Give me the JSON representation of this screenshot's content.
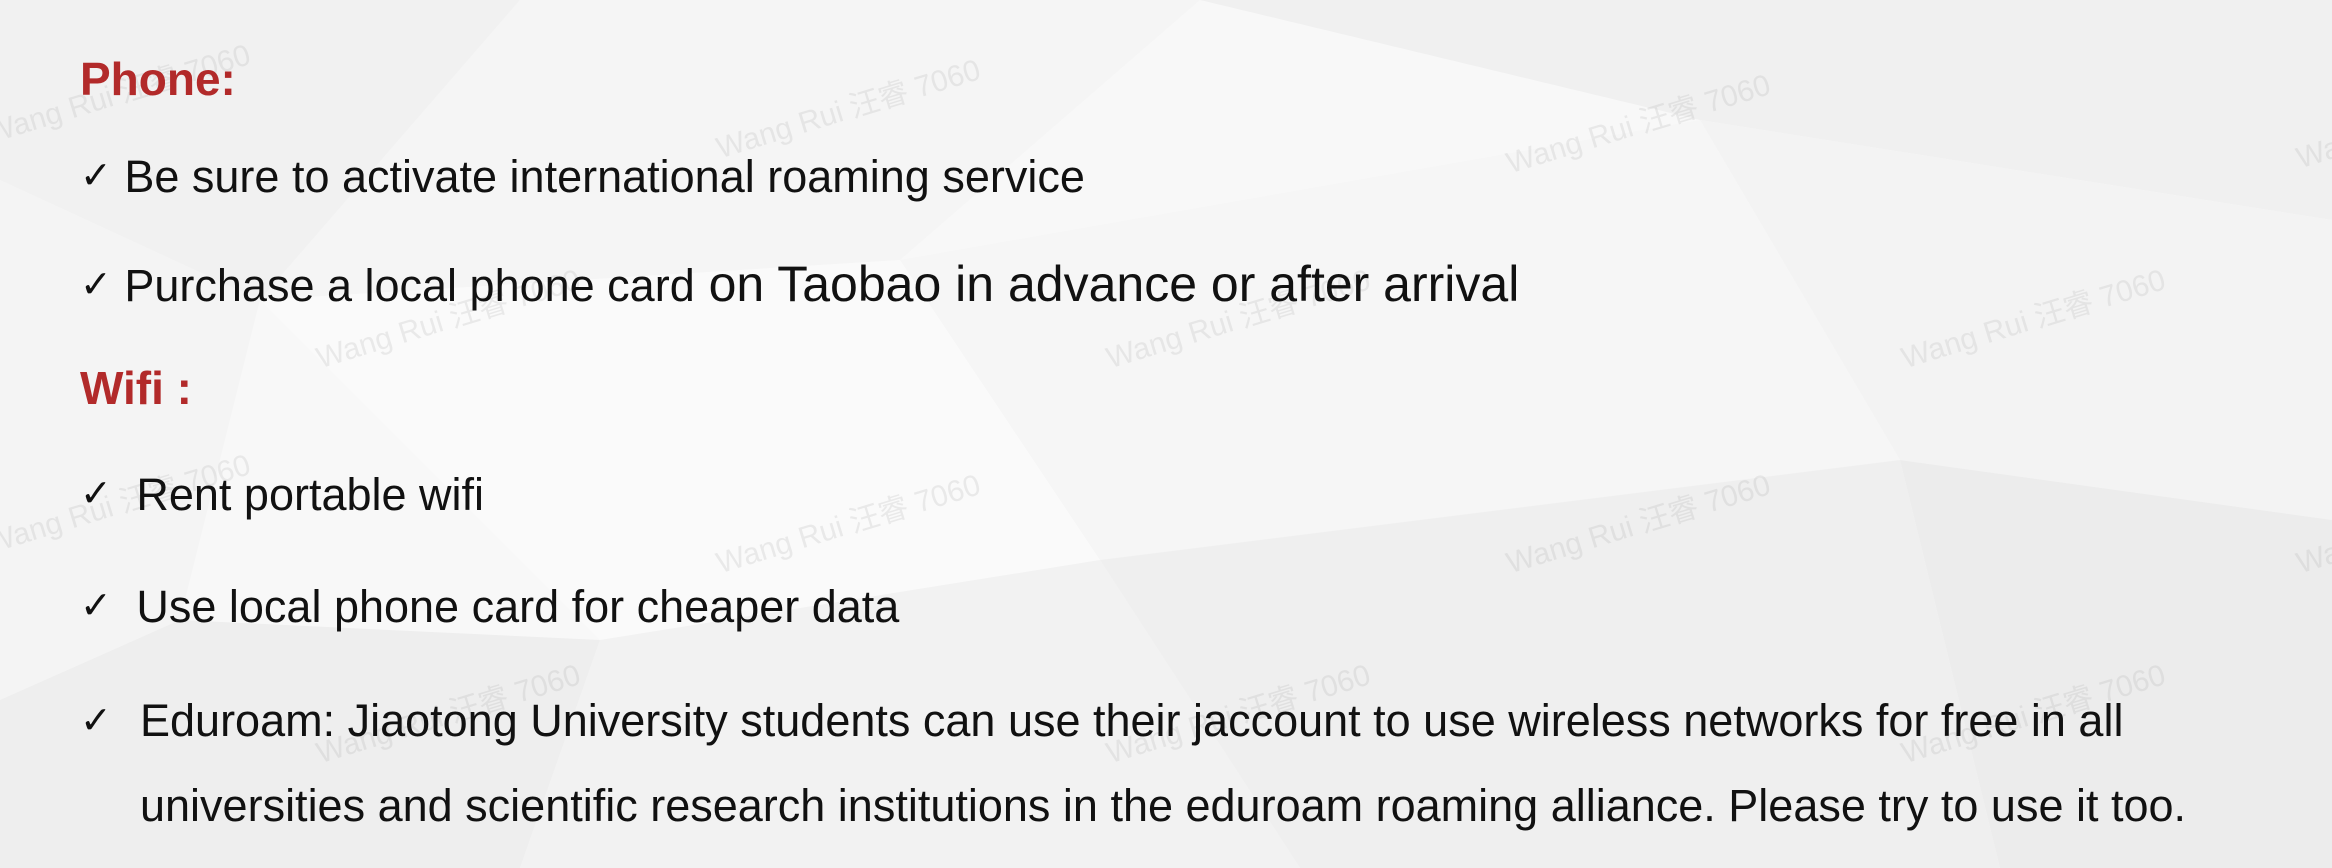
{
  "watermark": "Wang Rui 汪睿 7060",
  "colors": {
    "heading": "#b22a2a",
    "text": "#111111",
    "background": "#f7f7f7"
  },
  "sections": {
    "phone": {
      "heading": "Phone:",
      "items": [
        {
          "check": "✓",
          "text": "Be sure to activate international roaming service"
        },
        {
          "check": "✓",
          "text_a": "Purchase a local phone card",
          "text_b": " on Taobao in advance or after arrival"
        }
      ]
    },
    "wifi": {
      "heading": "Wifi :",
      "items": [
        {
          "check": "✓",
          "text": "Rent portable wifi"
        },
        {
          "check": "✓",
          "text": "Use local phone card for cheaper data"
        },
        {
          "check": "✓",
          "text": "Eduroam: Jiaotong University students can use their jaccount to use wireless networks for free in all universities and scientific research institutions in the eduroam roaming alliance. Please try to use it too."
        }
      ]
    }
  }
}
